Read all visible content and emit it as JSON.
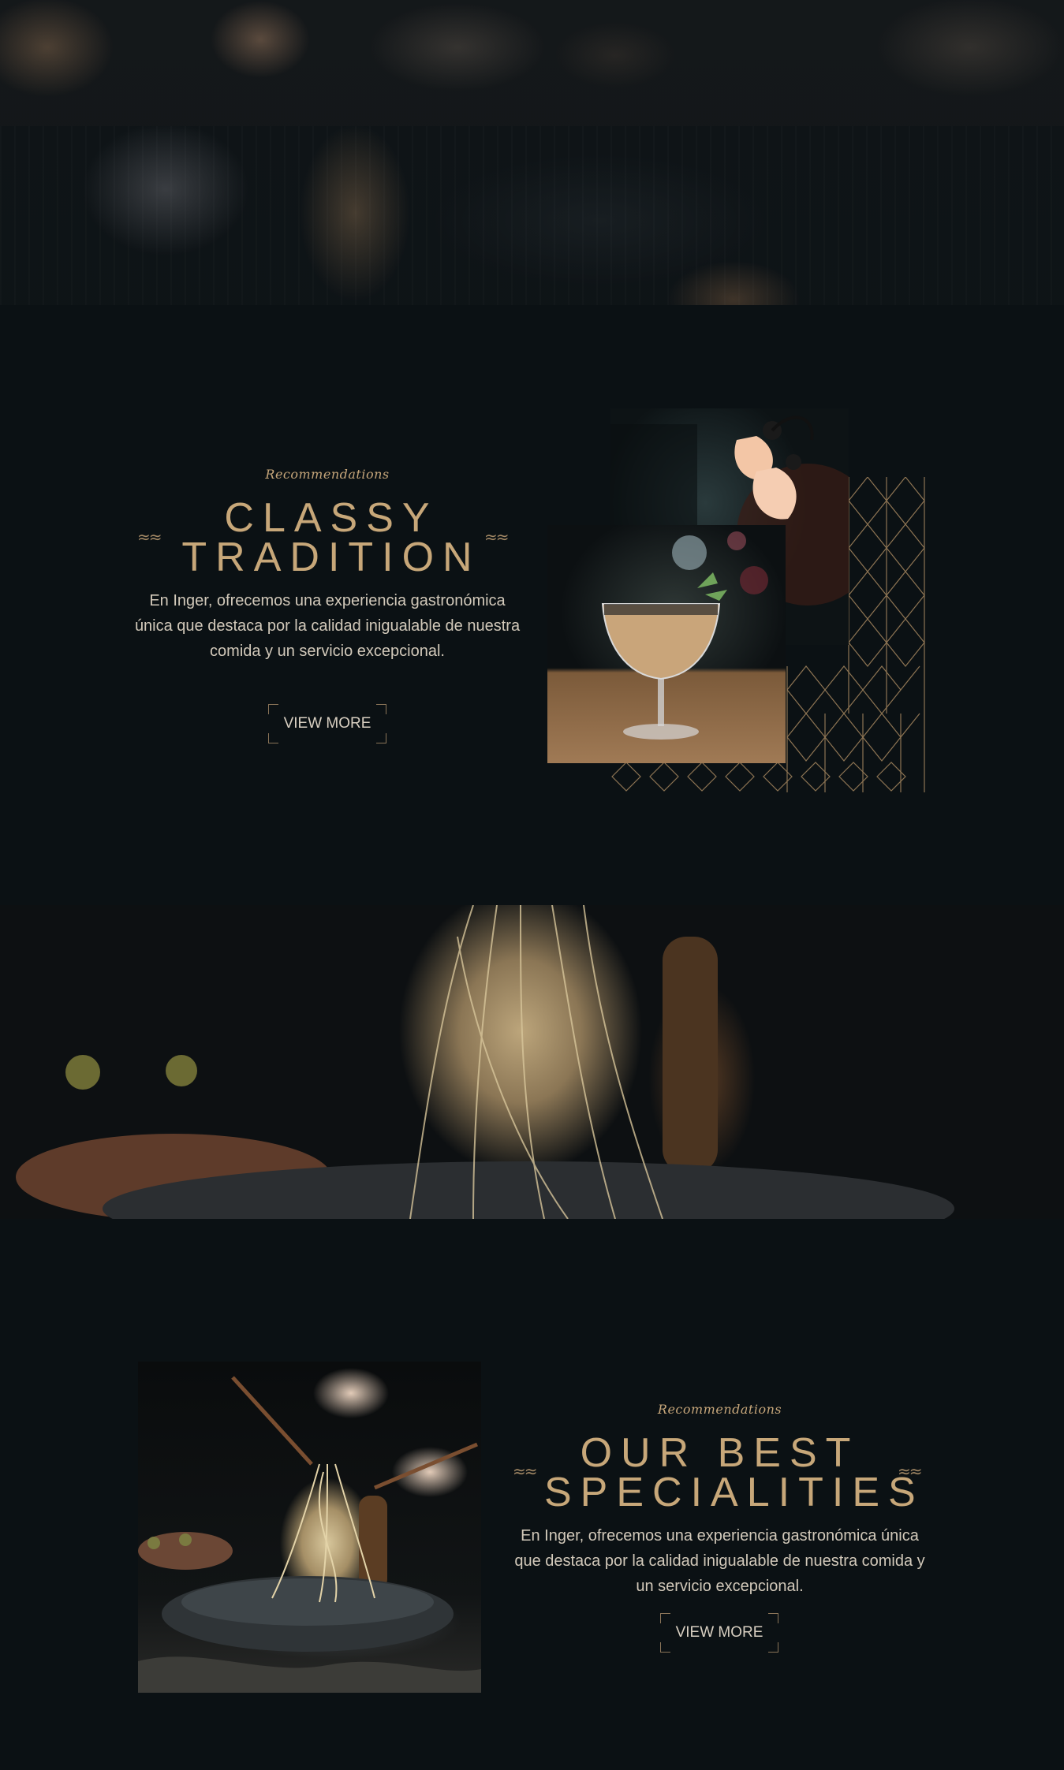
{
  "section_classy": {
    "eyebrow": "Recommendations",
    "title_line1": "CLASSY",
    "title_line2": "TRADITION",
    "body": "En Inger, ofrecemos una experiencia gastronómica única que destaca por la calidad inigualable de nuestra comida y un servicio excepcional.",
    "button_label": "VIEW MORE"
  },
  "section_specialities": {
    "eyebrow": "Recommendations",
    "title_line1": "OUR BEST",
    "title_line2": "SPECIALITIES",
    "body": "En Inger, ofrecemos una experiencia gastronómica única que destaca por la calidad inigualable de nuestra comida y un servicio excepcional.",
    "button_label": "VIEW MORE"
  },
  "decor": {
    "divider_glyph": "≈≈",
    "accent_color": "#c7a779",
    "background_color": "#0b1114"
  }
}
